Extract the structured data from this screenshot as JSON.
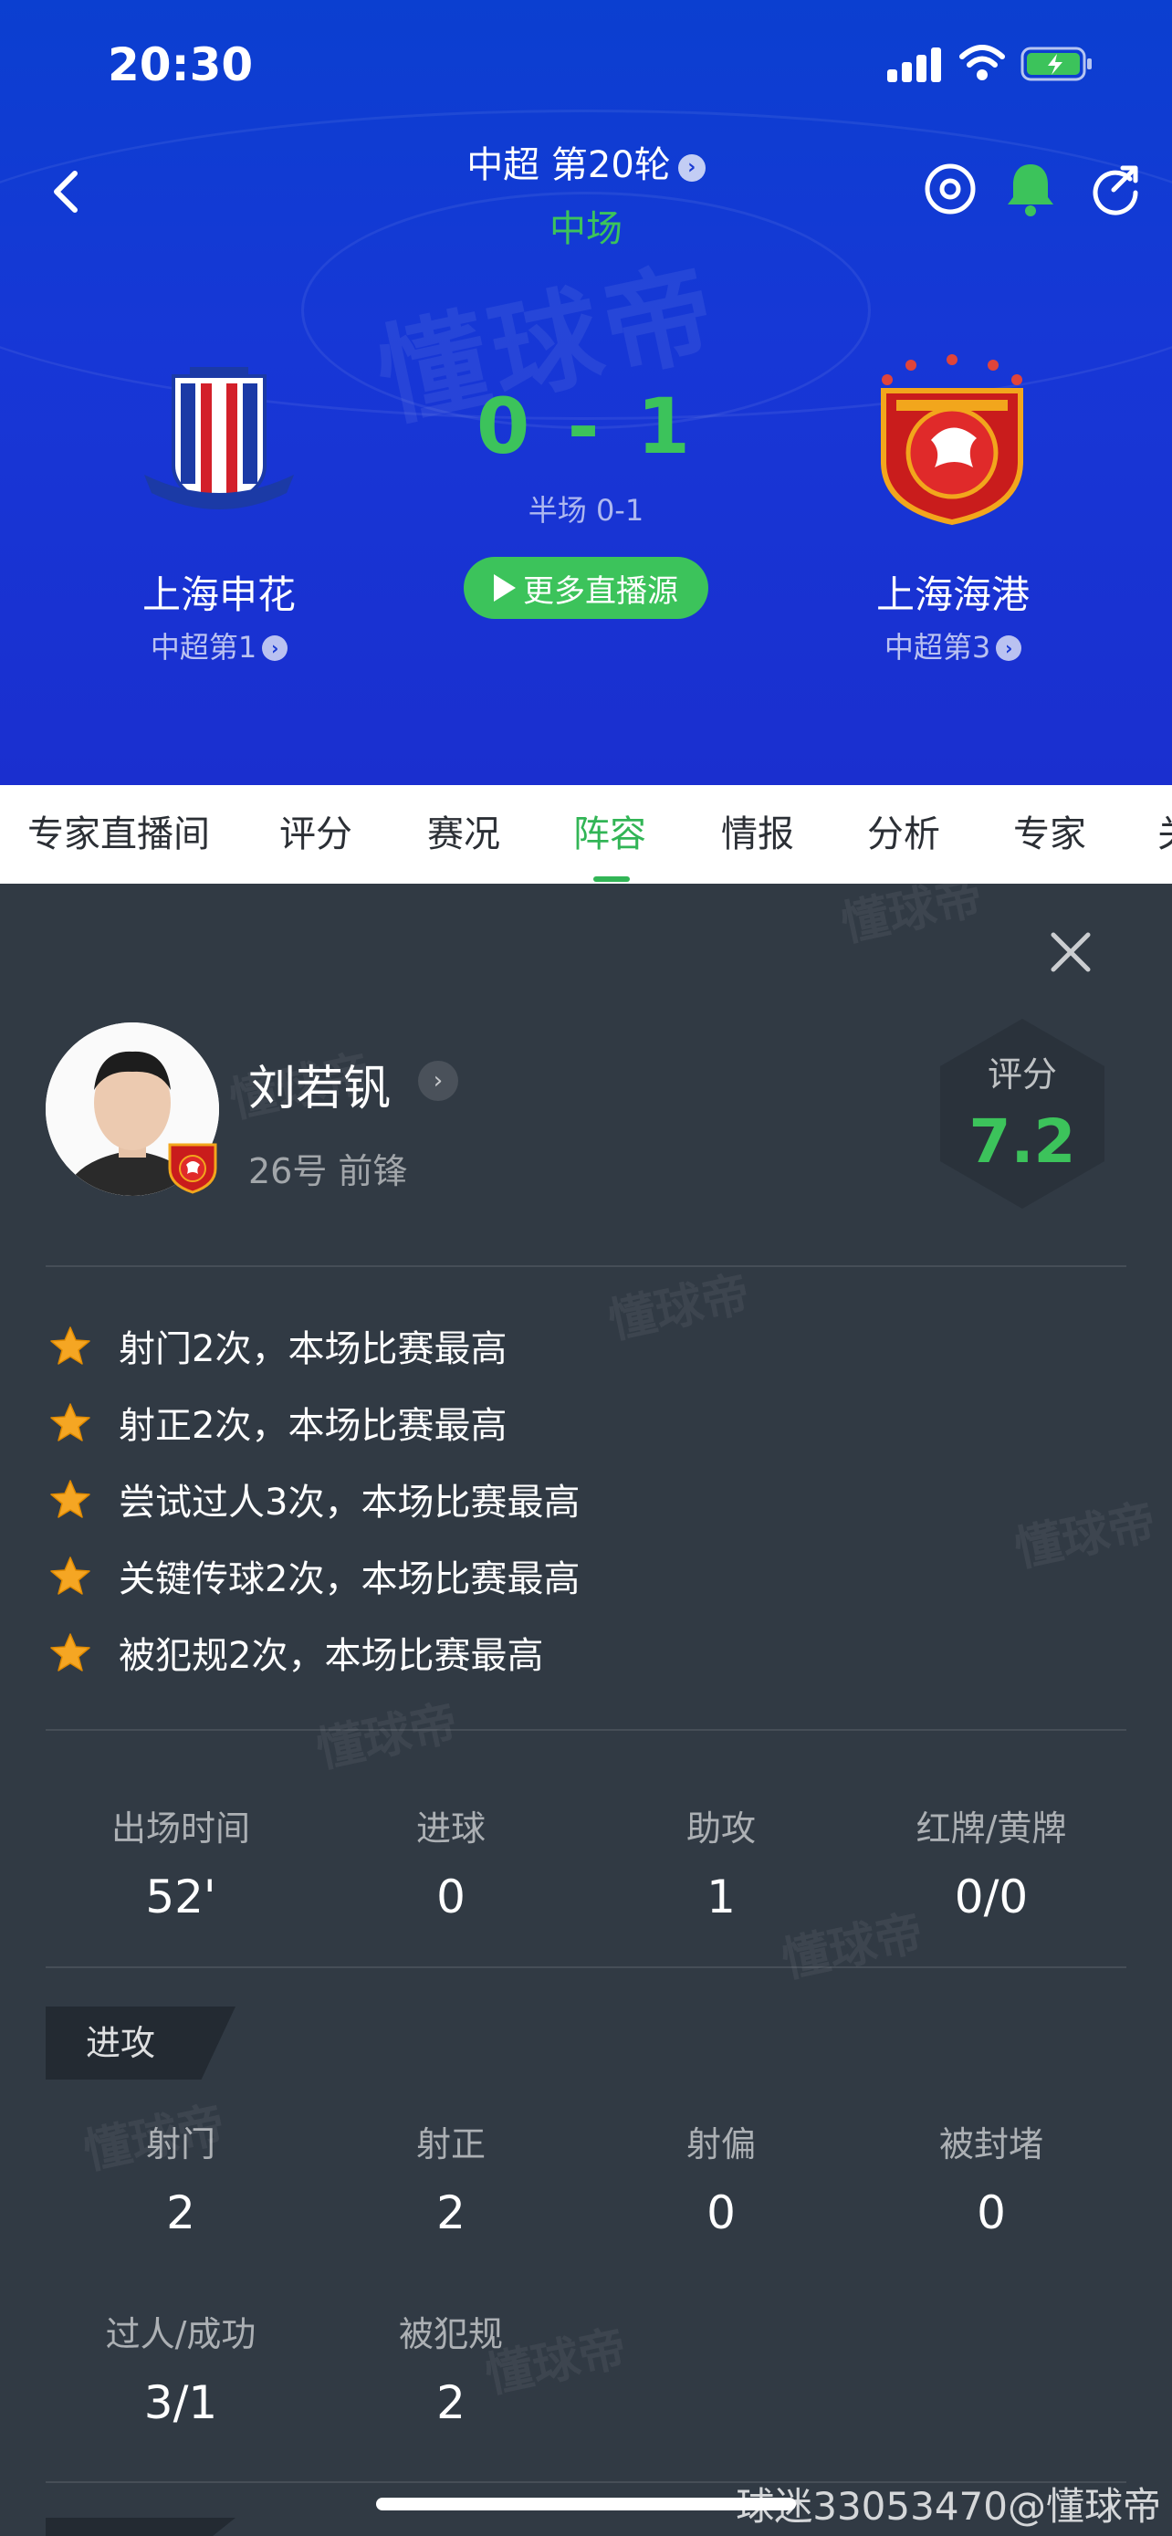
{
  "status_bar": {
    "time": "20:30"
  },
  "match": {
    "round": "中超 第20轮",
    "phase": "中场",
    "score": "0 - 1",
    "halftime": "半场 0-1",
    "live_button": "更多直播源",
    "home": {
      "name": "上海申花",
      "rank": "中超第1"
    },
    "away": {
      "name": "上海海港",
      "rank": "中超第3"
    }
  },
  "tabs": [
    "专家直播间",
    "评分",
    "赛况",
    "阵容",
    "情报",
    "分析",
    "专家",
    "关"
  ],
  "active_tab": "阵容",
  "watermark": "懂球帝",
  "player": {
    "name": "刘若钒",
    "meta": "26号 前锋",
    "rating_label": "评分",
    "rating": "7.2",
    "highlights": [
      "射门2次，本场比赛最高",
      "射正2次，本场比赛最高",
      "尝试过人3次，本场比赛最高",
      "关键传球2次，本场比赛最高",
      "被犯规2次，本场比赛最高"
    ],
    "summary": [
      {
        "label": "出场时间",
        "value": "52'"
      },
      {
        "label": "进球",
        "value": "0"
      },
      {
        "label": "助攻",
        "value": "1"
      },
      {
        "label": "红牌/黄牌",
        "value": "0/0"
      }
    ],
    "attack_section": "进攻",
    "attack": [
      {
        "label": "射门",
        "value": "2"
      },
      {
        "label": "射正",
        "value": "2"
      },
      {
        "label": "射偏",
        "value": "0"
      },
      {
        "label": "被封堵",
        "value": "0"
      },
      {
        "label": "过人/成功",
        "value": "3/1"
      },
      {
        "label": "被犯规",
        "value": "2"
      }
    ]
  },
  "footer_watermark": "球迷33053470@懂球帝",
  "colors": {
    "header_blue": "#1a35d2",
    "accent_green": "#3cc35b",
    "panel_bg": "#313a44"
  },
  "icons": [
    "back-icon",
    "target-icon",
    "bell-icon",
    "share-icon",
    "close-icon",
    "star-icon",
    "play-icon"
  ]
}
